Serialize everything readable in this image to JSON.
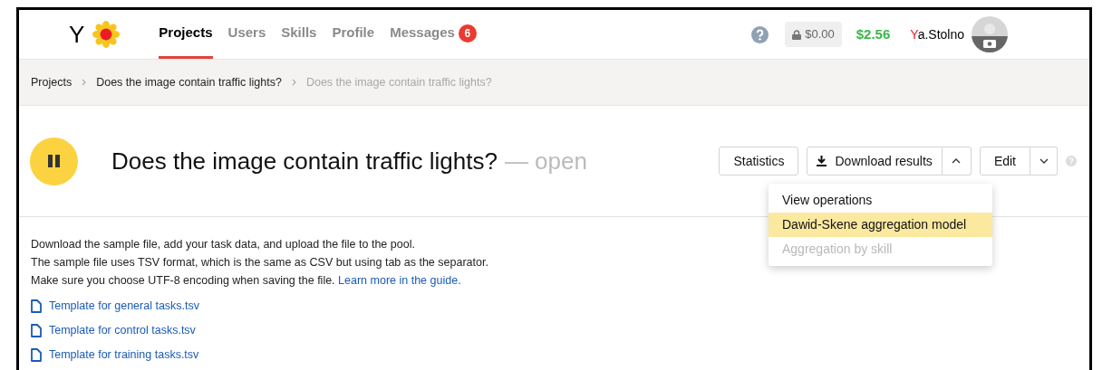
{
  "header": {
    "logo_text": "Y",
    "nav": [
      {
        "label": "Projects",
        "selected": true
      },
      {
        "label": "Users",
        "selected": false
      },
      {
        "label": "Skills",
        "selected": false
      },
      {
        "label": "Profile",
        "selected": false
      },
      {
        "label": "Messages",
        "selected": false,
        "badge": "6"
      }
    ],
    "locked_balance": "$0.00",
    "balance": "$2.56",
    "user_name": "Ya.Stolno"
  },
  "breadcrumbs": [
    {
      "label": "Projects",
      "current": false
    },
    {
      "label": "Does the image contain traffic lights?",
      "current": false
    },
    {
      "label": "Does the image contain traffic lights?",
      "current": true
    }
  ],
  "project": {
    "title": "Does the image contain traffic lights?",
    "status": "— open",
    "paused": true
  },
  "actions": {
    "statistics": "Statistics",
    "download": "Download results",
    "download_menu_expanded": true,
    "edit": "Edit"
  },
  "download_menu": [
    {
      "label": "View operations",
      "selected": false,
      "disabled": false
    },
    {
      "label": "Dawid-Skene aggregation model",
      "selected": true,
      "disabled": false
    },
    {
      "label": "Aggregation by skill",
      "selected": false,
      "disabled": true
    }
  ],
  "instructions": [
    "Download the sample file, add your task data, and upload the file to the pool.",
    "The sample file uses TSV format, which is the same as CSV but using tab as the separator."
  ],
  "instructions_last": {
    "text": "Make sure you choose UTF-8 encoding when saving the file.",
    "link": "Learn more in the guide."
  },
  "templates": [
    "Template for general tasks.tsv",
    "Template for control tasks.tsv",
    "Template for training tasks.tsv"
  ]
}
